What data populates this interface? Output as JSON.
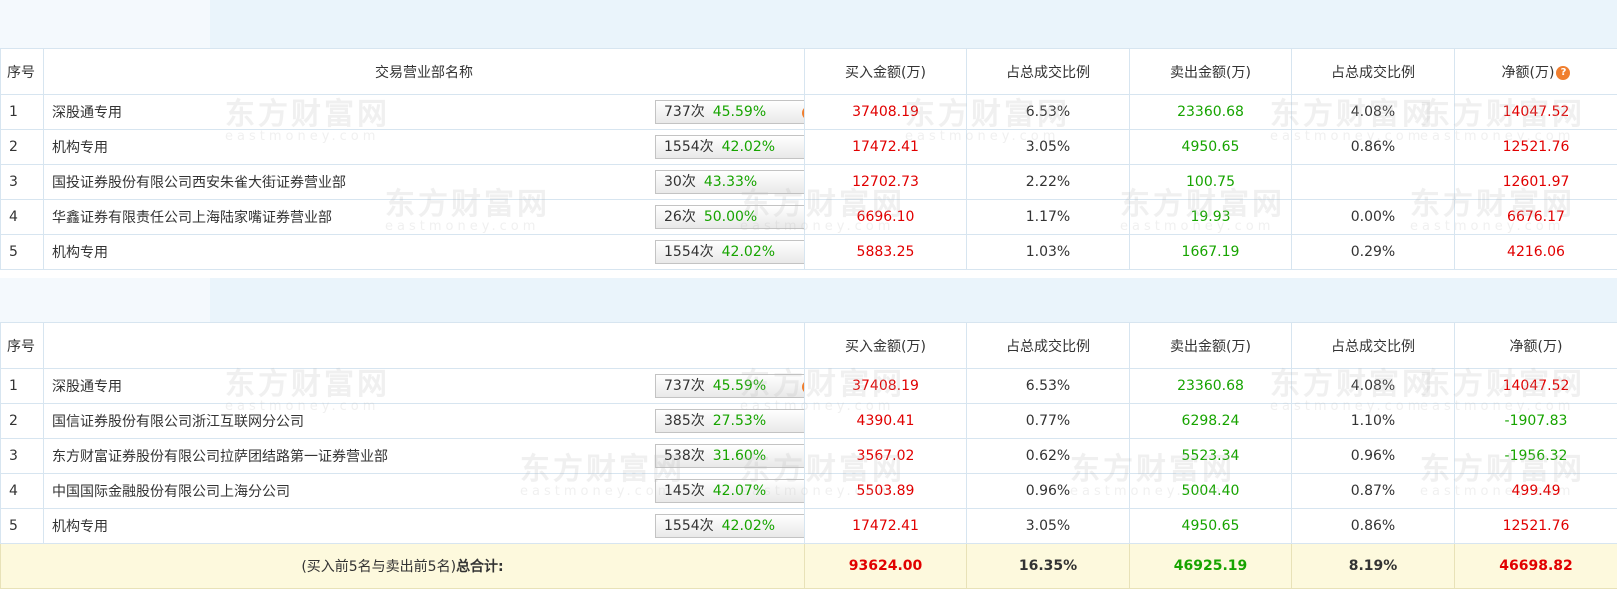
{
  "watermark": {
    "cn": "东方财富网",
    "en": "eastmoney.com"
  },
  "buy_table": {
    "headers": {
      "idx": "序号",
      "name": "交易营业部名称",
      "buy": "买入金额(万)",
      "buy_pct": "占总成交比例",
      "sell": "卖出金额(万)",
      "sell_pct": "占总成交比例",
      "net": "净额(万)"
    },
    "rows": [
      {
        "idx": "1",
        "name": "深股通专用",
        "count": "737次",
        "rate": "45.59%",
        "badge": "question",
        "buy": "37408.19",
        "buy_pct": "6.53%",
        "sell": "23360.68",
        "sell_pct": "4.08%",
        "net": "14047.52"
      },
      {
        "idx": "2",
        "name": "机构专用",
        "count": "1554次",
        "rate": "42.02%",
        "badge": "arrow",
        "buy": "17472.41",
        "buy_pct": "3.05%",
        "sell": "4950.65",
        "sell_pct": "0.86%",
        "net": "12521.76"
      },
      {
        "idx": "3",
        "name": "国投证券股份有限公司西安朱雀大街证券营业部",
        "count": "30次",
        "rate": "43.33%",
        "badge": "arrow",
        "buy": "12702.73",
        "buy_pct": "2.22%",
        "sell": "100.75",
        "sell_pct": "",
        "net": "12601.97"
      },
      {
        "idx": "4",
        "name": "华鑫证券有限责任公司上海陆家嘴证券营业部",
        "count": "26次",
        "rate": "50.00%",
        "badge": "arrow",
        "buy": "6696.10",
        "buy_pct": "1.17%",
        "sell": "19.93",
        "sell_pct": "0.00%",
        "net": "6676.17"
      },
      {
        "idx": "5",
        "name": "机构专用",
        "count": "1554次",
        "rate": "42.02%",
        "badge": "arrow",
        "buy": "5883.25",
        "buy_pct": "1.03%",
        "sell": "1667.19",
        "sell_pct": "0.29%",
        "net": "4216.06"
      }
    ]
  },
  "sell_table": {
    "headers": {
      "idx": "序号",
      "name": "",
      "buy": "买入金额(万)",
      "buy_pct": "占总成交比例",
      "sell": "卖出金额(万)",
      "sell_pct": "占总成交比例",
      "net": "净额(万)"
    },
    "rows": [
      {
        "idx": "1",
        "name": "深股通专用",
        "count": "737次",
        "rate": "45.59%",
        "badge": "question",
        "buy": "37408.19",
        "buy_pct": "6.53%",
        "sell": "23360.68",
        "sell_pct": "4.08%",
        "net": "14047.52"
      },
      {
        "idx": "2",
        "name": "国信证券股份有限公司浙江互联网分公司",
        "count": "385次",
        "rate": "27.53%",
        "badge": "arrow",
        "buy": "4390.41",
        "buy_pct": "0.77%",
        "sell": "6298.24",
        "sell_pct": "1.10%",
        "net": "-1907.83"
      },
      {
        "idx": "3",
        "name": "东方财富证券股份有限公司拉萨团结路第一证券营业部",
        "count": "538次",
        "rate": "31.60%",
        "badge": "arrow",
        "buy": "3567.02",
        "buy_pct": "0.62%",
        "sell": "5523.34",
        "sell_pct": "0.96%",
        "net": "-1956.32"
      },
      {
        "idx": "4",
        "name": "中国国际金融股份有限公司上海分公司",
        "count": "145次",
        "rate": "42.07%",
        "badge": "arrow",
        "buy": "5503.89",
        "buy_pct": "0.96%",
        "sell": "5004.40",
        "sell_pct": "0.87%",
        "net": "499.49"
      },
      {
        "idx": "5",
        "name": "机构专用",
        "count": "1554次",
        "rate": "42.02%",
        "badge": "arrow",
        "buy": "17472.41",
        "buy_pct": "3.05%",
        "sell": "4950.65",
        "sell_pct": "0.86%",
        "net": "12521.76"
      }
    ],
    "total": {
      "label_prefix": "(买入前5名与卖出前5名)",
      "label_bold": "总合计:",
      "buy": "93624.00",
      "buy_pct": "16.35%",
      "sell": "46925.19",
      "sell_pct": "8.19%",
      "net": "46698.82"
    }
  },
  "colors": {
    "buy": "#e10000",
    "sell": "#17a400",
    "badge": "#f07e2e",
    "header_band": "#eaf4fb",
    "total_bg": "#fdf9dd"
  }
}
